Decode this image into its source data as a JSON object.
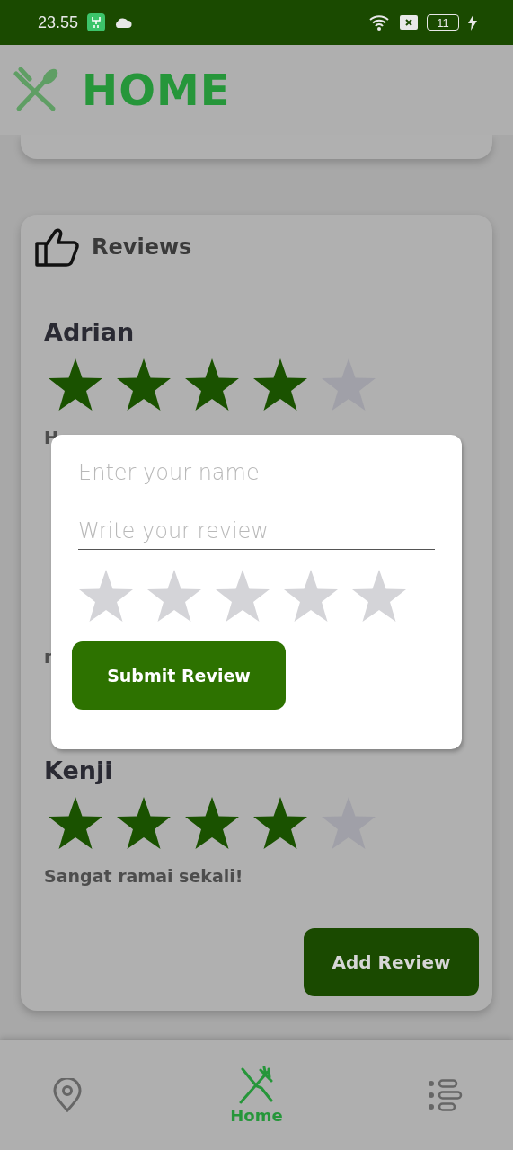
{
  "status_bar": {
    "time": "23.55",
    "battery": "11"
  },
  "header": {
    "title": "HOME"
  },
  "reviews": {
    "title": "Reviews",
    "items": [
      {
        "name": "Adrian",
        "stars": 4,
        "lines": [
          "H"
        ]
      },
      {
        "lines": [
          "r"
        ]
      },
      {
        "name": "Kenji",
        "stars": 4,
        "lines": [
          "Sangat ramai sekali!"
        ]
      }
    ],
    "add_button": "Add Review"
  },
  "dialog": {
    "name_placeholder": "Enter your name",
    "review_placeholder": "Write your review",
    "rating": {
      "stars": 0
    },
    "submit": "Submit Review"
  },
  "nav": [
    {
      "kind": "location",
      "selected": false
    },
    {
      "kind": "dining",
      "label": "Home",
      "selected": true
    },
    {
      "kind": "list",
      "selected": false
    }
  ]
}
